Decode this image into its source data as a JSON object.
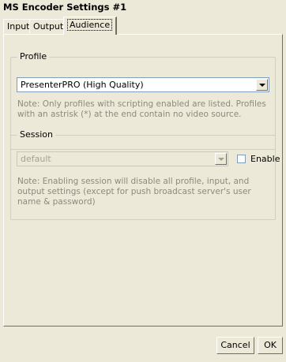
{
  "window": {
    "title": "MS Encoder Settings #1"
  },
  "tabs": [
    {
      "label": "Input"
    },
    {
      "label": "Output"
    },
    {
      "label": "Audience"
    }
  ],
  "profile": {
    "legend": "Profile",
    "selected": "PresenterPRO (High Quality)",
    "note": "Note: Only profiles with scripting enabled are listed.  Profiles with an astrisk (*) at the end contain no video source."
  },
  "session": {
    "legend": "Session",
    "placeholder": "default",
    "enable_label": "Enable",
    "enable_checked": false,
    "note": "Note: Enabling session will disable all profile, input, and output settings (except for push broadcast server's user name & password)"
  },
  "footer": {
    "cancel_label": "Cancel",
    "ok_label": "OK"
  }
}
